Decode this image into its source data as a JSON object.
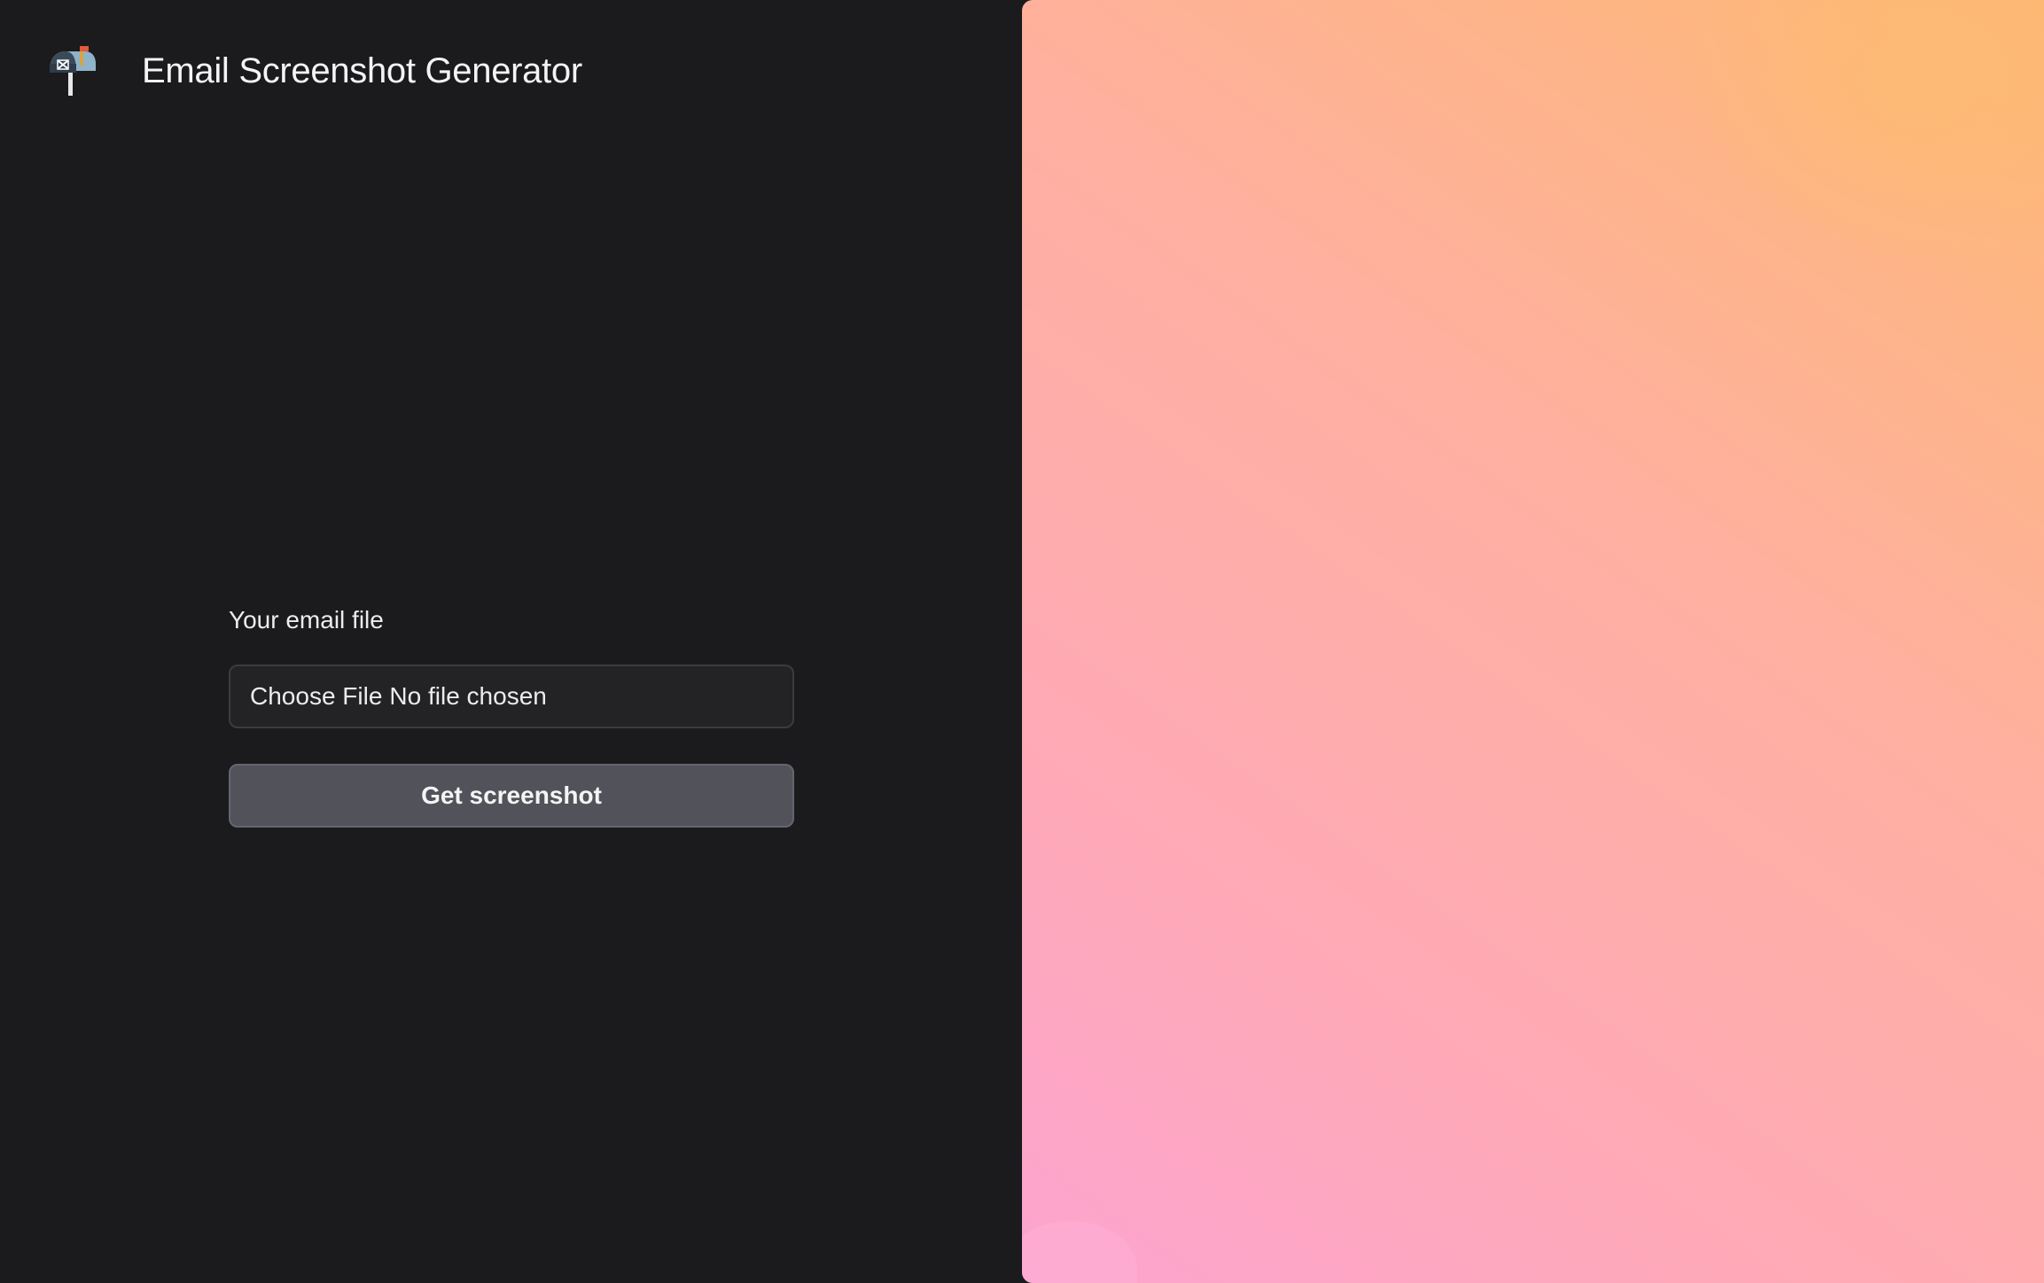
{
  "header": {
    "logo_icon": "mailbox-icon",
    "title": "Email Screenshot Generator"
  },
  "form": {
    "label": "Your email file",
    "file_input": {
      "button_label": "Choose File",
      "status_text": "No file chosen"
    },
    "submit_label": "Get screenshot"
  },
  "preview": {
    "gradient_colors": [
      "#fda4cf",
      "#ffaab4",
      "#ffb0a0",
      "#fdb873"
    ]
  },
  "colors": {
    "background": "#1b1b1d",
    "input_background": "#232326",
    "button_background": "#52525b",
    "text": "#ececee"
  }
}
